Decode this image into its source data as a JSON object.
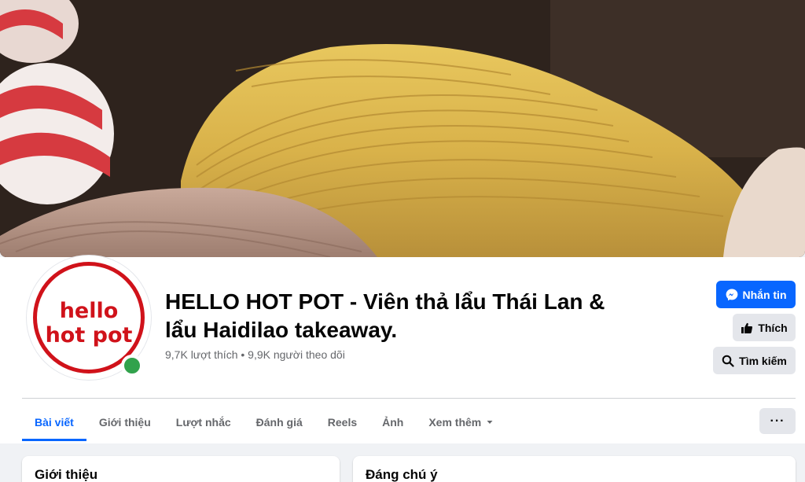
{
  "page": {
    "name": "HELLO HOT POT - Viên thả lẩu Thái Lan & lẩu Haidilao takeaway.",
    "stats": "9,7K lượt thích • 9,9K người theo dõi",
    "avatar_text": "hello\nhot pot"
  },
  "actions": {
    "message": "Nhắn tin",
    "like": "Thích",
    "search": "Tìm kiếm"
  },
  "tabs": [
    {
      "label": "Bài viết",
      "active": true
    },
    {
      "label": "Giới thiệu"
    },
    {
      "label": "Lượt nhắc"
    },
    {
      "label": "Đánh giá"
    },
    {
      "label": "Reels"
    },
    {
      "label": "Ảnh"
    },
    {
      "label": "Xem thêm"
    }
  ],
  "more_menu": "···",
  "cards": {
    "intro_title": "Giới thiệu",
    "featured_title": "Đáng chú ý"
  },
  "colors": {
    "brand_blue": "#0866ff",
    "logo_red": "#d0121a",
    "online_green": "#31a24c"
  }
}
